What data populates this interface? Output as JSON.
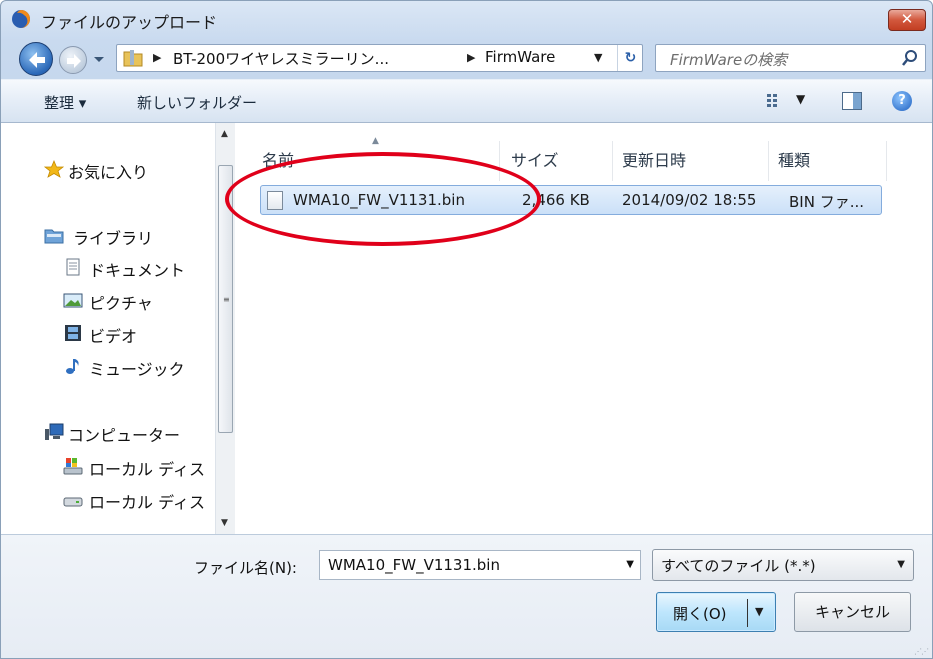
{
  "window": {
    "title": "ファイルのアップロード",
    "close_label": "✕"
  },
  "address": {
    "crumbs": [
      "BT-200ワイヤレスミラーリン...",
      "FirmWare"
    ],
    "search_placeholder": "FirmWareの検索"
  },
  "toolbar": {
    "organize": "整理 ▾",
    "new_folder": "新しいフォルダー",
    "help": "?"
  },
  "nav": {
    "favorites": "お気に入り",
    "libraries": "ライブラリ",
    "documents": "ドキュメント",
    "pictures": "ピクチャ",
    "videos": "ビデオ",
    "music": "ミュージック",
    "computer": "コンピューター",
    "local_disk_1": "ローカル ディス",
    "local_disk_2": "ローカル ディス"
  },
  "columns": {
    "name": "名前",
    "size": "サイズ",
    "date": "更新日時",
    "type": "種類"
  },
  "file": {
    "name": "WMA10_FW_V1131.bin",
    "size": "2,466 KB",
    "date": "2014/09/02 18:55",
    "type": "BIN ファ..."
  },
  "bottom": {
    "filename_label": "ファイル名(N):",
    "filename_value": "WMA10_FW_V1131.bin",
    "filter_value": "すべてのファイル (*.*)",
    "open_label": "開く(O)",
    "cancel_label": "キャンセル"
  },
  "colors": {
    "annotation": "#e0001a",
    "selection": "#cbe0f8",
    "chrome": "#c9daef"
  }
}
